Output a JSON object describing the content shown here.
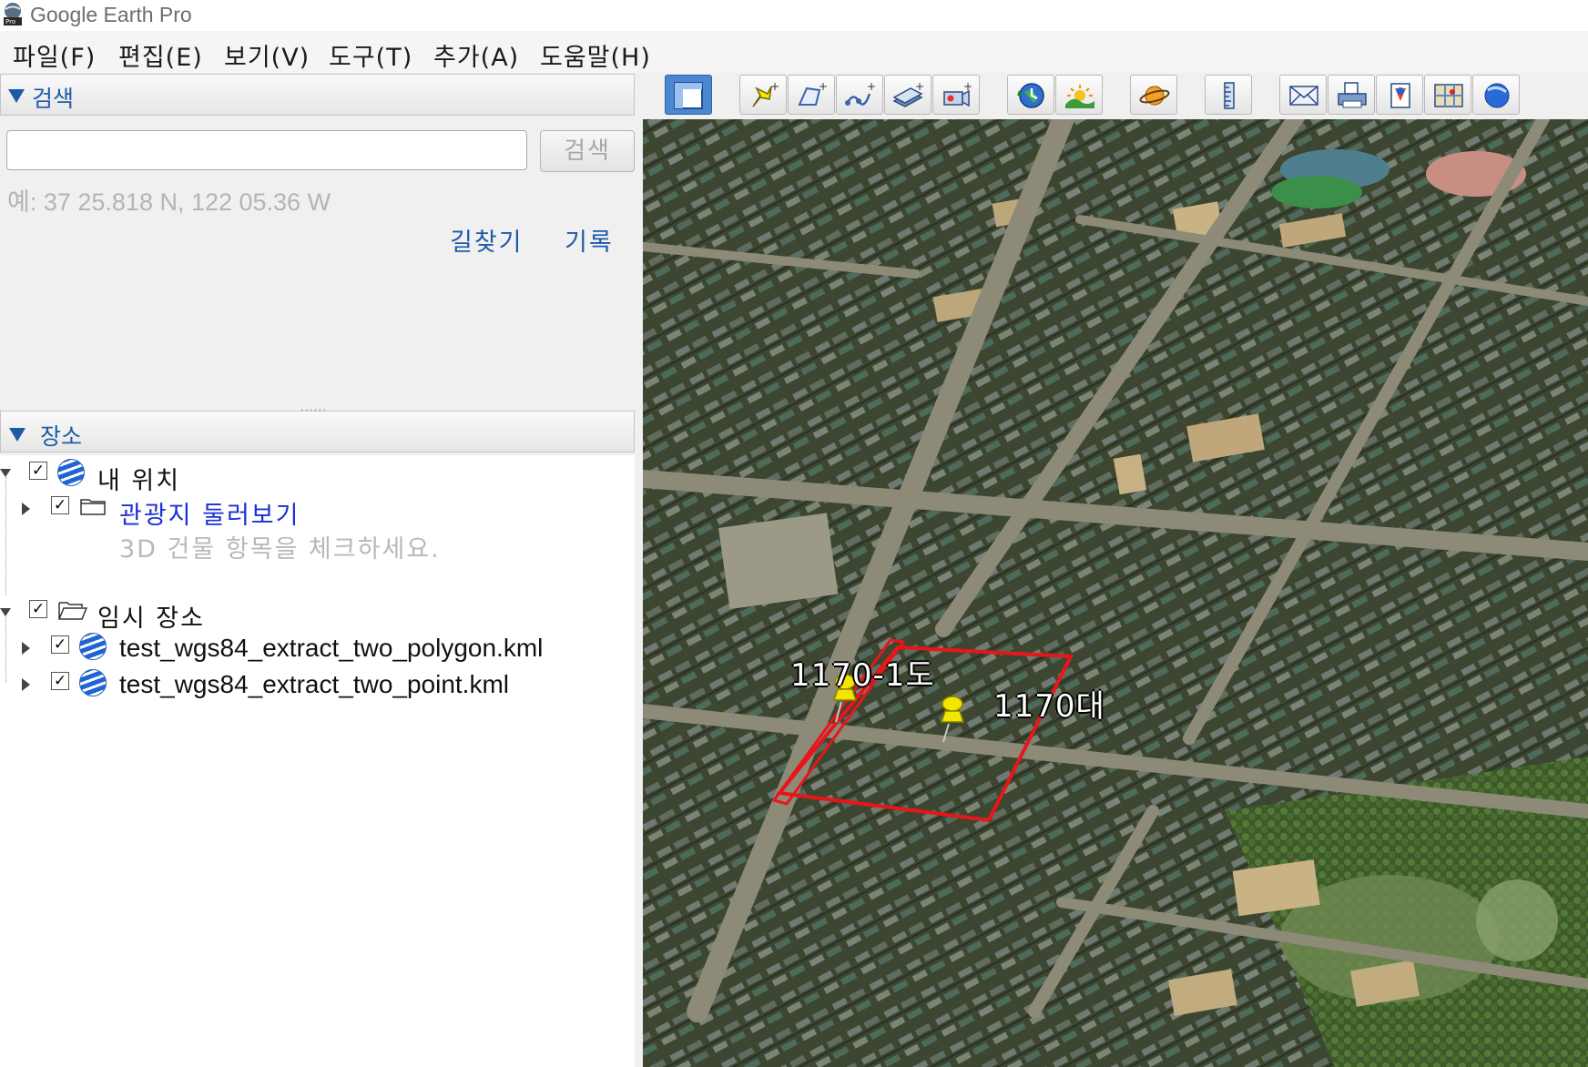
{
  "window": {
    "title": "Google Earth Pro"
  },
  "menu": [
    "파일(F)",
    "편집(E)",
    "보기(V)",
    "도구(T)",
    "추가(A)",
    "도움말(H)"
  ],
  "search": {
    "header": "검색",
    "input_value": "",
    "button": "검색",
    "hint": "예: 37 25.818 N, 122 05.36 W",
    "link_directions": "길찾기",
    "link_history": "기록"
  },
  "places": {
    "header": "장소",
    "my_places": "내 위치",
    "sightseeing": "관광지 둘러보기",
    "sightseeing_hint": "3D 건물 항목을 체크하세요.",
    "temporary": "임시 장소",
    "kml_polygon": "test_wgs84_extract_two_polygon.kml",
    "kml_point": "test_wgs84_extract_two_point.kml"
  },
  "toolbar": {
    "buttons": [
      "sidebar-toggle-icon",
      "placemark-icon",
      "polygon-icon",
      "path-icon",
      "image-overlay-icon",
      "record-tour-icon",
      "historical-imagery-icon",
      "sunlight-icon",
      "planets-icon",
      "ruler-icon",
      "email-icon",
      "print-icon",
      "save-image-icon",
      "view-in-maps-icon",
      "earth-community-icon"
    ]
  },
  "map": {
    "placemark_1": "1170-1도",
    "placemark_2": "1170대"
  },
  "colors": {
    "accent": "#1f5aa6",
    "link": "#1c2fd6",
    "polygon": "#e8161b",
    "pin": "#f2e600"
  }
}
